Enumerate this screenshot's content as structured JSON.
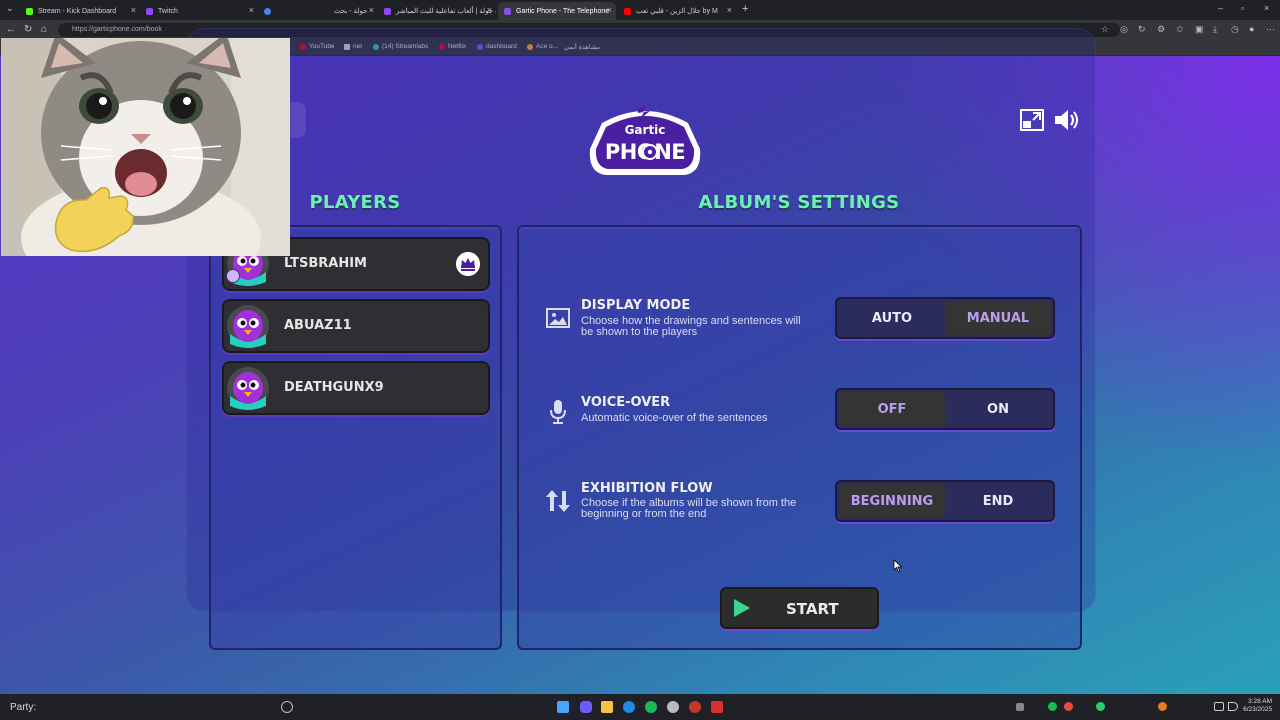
{
  "browser": {
    "tabs": [
      {
        "label": "Stream - Kick Dashboard",
        "color": "#53fc18"
      },
      {
        "label": "Twitch",
        "color": "#9146ff"
      },
      {
        "label": "",
        "color": "#4285f4"
      },
      {
        "label": "جولة - بحث",
        "color": "#4285f4"
      },
      {
        "label": "لعبة جولة | ألعاب تفاعلية للبث المباشر",
        "color": "#9146ff"
      },
      {
        "label": "Gartic Phone - The Telephone",
        "color": "#8a4de8"
      },
      {
        "label": "جلال الزين - قلبي تعب by M",
        "color": "#ff0000"
      }
    ],
    "url": "https://garticphone.com/book",
    "bookmarks": [
      "YouTube",
      "net",
      "(14) Streamlabs",
      "Netflix",
      "dashboard",
      "Ace o...",
      "مشاهدة أنمي"
    ]
  },
  "game": {
    "players_title": "PLAYERS",
    "settings_title": "ALBUM'S SETTINGS",
    "players": [
      {
        "name": "LTSBRAHIM",
        "host": true
      },
      {
        "name": "ABUAZ11",
        "host": false
      },
      {
        "name": "DEATHGUNX9",
        "host": false
      }
    ],
    "settings": [
      {
        "title": "DISPLAY MODE",
        "desc1": "Choose how the drawings and sentences will",
        "desc2": "be shown to the players",
        "icon": "image-icon",
        "options": [
          "AUTO",
          "MANUAL"
        ],
        "selected": "MANUAL"
      },
      {
        "title": "VOICE-OVER",
        "desc1": "Automatic voice-over of the sentences",
        "desc2": "",
        "icon": "microphone-icon",
        "options": [
          "OFF",
          "ON"
        ],
        "selected": "OFF"
      },
      {
        "title": "EXHIBITION FLOW",
        "desc1": "Choose if the albums will be shown from the",
        "desc2": "beginning or from the end",
        "icon": "sort-arrows-icon",
        "options": [
          "BEGINNING",
          "END"
        ],
        "selected": "BEGINNING"
      }
    ],
    "start_label": "START",
    "accent": "#6ef0b5",
    "brand": "#5a2ec8"
  },
  "taskbar": {
    "party_label": "Party:",
    "time": "3:28 AM",
    "date": "6/23/2025"
  }
}
